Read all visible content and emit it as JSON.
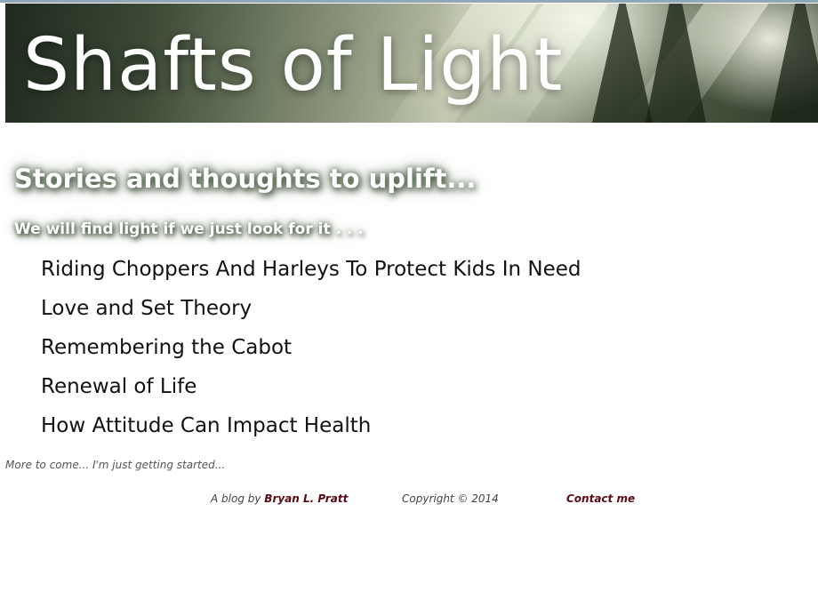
{
  "header": {
    "site_title": "Shafts of Light",
    "tagline": "Stories and thoughts to uplift...",
    "subtagline": "We will find light if we just look for it . . ."
  },
  "posts": [
    "Riding Choppers And Harleys To Protect Kids In Need",
    "Love and Set Theory",
    "Remembering the Cabot",
    "Renewal of Life",
    "How Attitude Can Impact Health"
  ],
  "more_note": "More to come... I'm just getting started...",
  "footer": {
    "byline_prefix": "A blog by",
    "author": "Bryan L. Pratt",
    "copyright": "Copyright © 2014",
    "contact": "Contact me"
  },
  "colors": {
    "link_dark_red": "#5a0a14",
    "tagline_glow": "#556b4e"
  },
  "icons": {
    "banner": "forest-sunlight-image"
  }
}
